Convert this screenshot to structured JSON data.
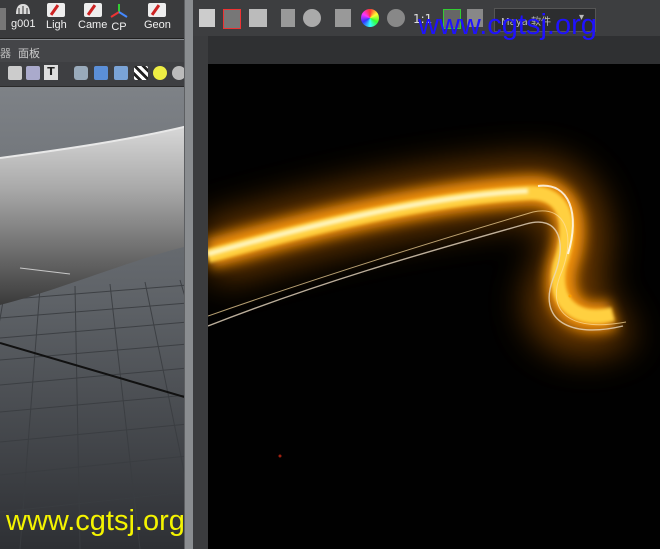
{
  "shelf": {
    "items": [
      {
        "label": "g001"
      },
      {
        "label": "Ligh"
      },
      {
        "label": "Came"
      },
      {
        "label": "CP"
      },
      {
        "label": "Geon"
      }
    ]
  },
  "left_panel": {
    "menu_item": "面板"
  },
  "render_view": {
    "ratio_label": "1:1",
    "camera_select": "Maya 软件"
  },
  "watermark": {
    "top": "www.cgtsj.org",
    "bottom": "www.cgtsj.org"
  },
  "colors": {
    "watermark_top": "#1f12ff",
    "watermark_bottom": "#f4f400",
    "glow": "#ffb020"
  }
}
